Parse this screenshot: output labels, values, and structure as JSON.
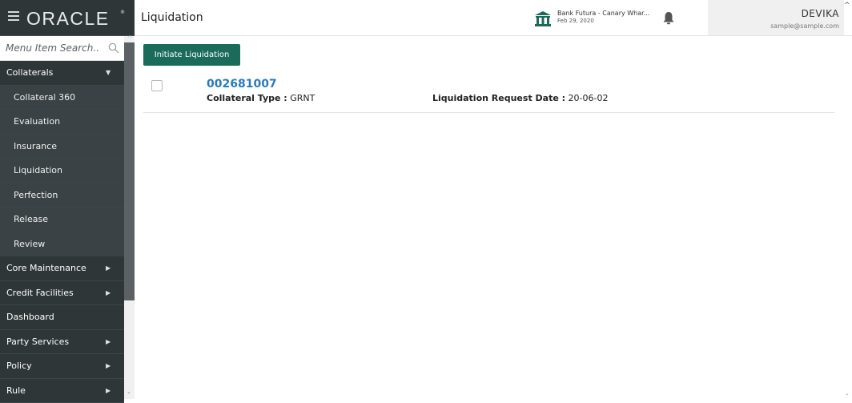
{
  "app": {
    "logo_text": "ORACLE",
    "logo_reg": "®",
    "page_title": "Liquidation"
  },
  "header": {
    "bank_name": "Bank Futura - Canary Whar...",
    "date": "Feb 29, 2020",
    "user_name": "DEVIKA",
    "user_email": "sample@sample.com"
  },
  "search": {
    "placeholder": "Menu Item Search..",
    "value": ""
  },
  "sidebar": {
    "items": [
      {
        "label": "Collaterals",
        "arrow": "▼",
        "level": 0
      },
      {
        "label": "Collateral 360",
        "level": 1
      },
      {
        "label": "Evaluation",
        "level": 1
      },
      {
        "label": "Insurance",
        "level": 1
      },
      {
        "label": "Liquidation",
        "level": 1
      },
      {
        "label": "Perfection",
        "level": 1
      },
      {
        "label": "Release",
        "level": 1
      },
      {
        "label": "Review",
        "level": 1
      },
      {
        "label": "Core Maintenance",
        "arrow": "▶",
        "level": 0
      },
      {
        "label": "Credit Facilities",
        "arrow": "▶",
        "level": 0
      },
      {
        "label": "Dashboard",
        "level": 0
      },
      {
        "label": "Party Services",
        "arrow": "▶",
        "level": 0
      },
      {
        "label": "Policy",
        "arrow": "▶",
        "level": 0
      },
      {
        "label": "Rule",
        "arrow": "▶",
        "level": 0
      }
    ]
  },
  "main": {
    "initiate_label": "Initiate Liquidation",
    "records": [
      {
        "id": "002681007",
        "collateral_type_label": "Collateral Type :",
        "collateral_type_value": "GRNT",
        "request_date_label": "Liquidation Request Date :",
        "request_date_value": "20-06-02"
      }
    ]
  },
  "colors": {
    "sidebar_bg": "#2f3638",
    "sidebar_sub_bg": "#3a4245",
    "accent_button": "#1b6b5b",
    "record_link": "#2a7ab8"
  },
  "icons": {
    "hamburger": "hamburger-icon",
    "search": "search-icon",
    "bank": "bank-icon",
    "bell": "bell-icon"
  }
}
